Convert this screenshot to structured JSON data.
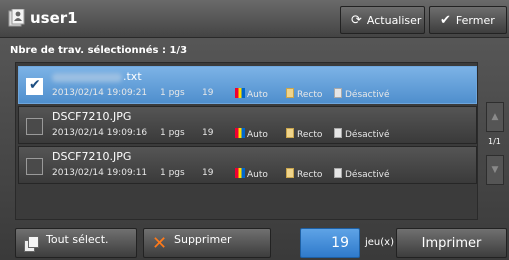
{
  "header": {
    "user": "user1",
    "refresh_label": "Actualiser",
    "close_label": "Fermer"
  },
  "selection_count": "Nbre de trav. sélectionnés : 1/3",
  "jobs": [
    {
      "name": ".txt",
      "selected": true,
      "date": "2013/02/14 19:09:21",
      "pages": "1 pgs",
      "sets": "19",
      "color": "Auto",
      "sides": "Recto",
      "staple": "Désactivé"
    },
    {
      "name": "DSCF7210.JPG",
      "selected": false,
      "date": "2013/02/14 19:09:16",
      "pages": "1 pgs",
      "sets": "19",
      "color": "Auto",
      "sides": "Recto",
      "staple": "Désactivé"
    },
    {
      "name": "DSCF7210.JPG",
      "selected": false,
      "date": "2013/02/14 19:09:11",
      "pages": "1 pgs",
      "sets": "19",
      "color": "Auto",
      "sides": "Recto",
      "staple": "Désactivé"
    }
  ],
  "page_indicator": "1/1",
  "footer": {
    "select_all_label": "Tout sélect.",
    "delete_label": "Supprimer",
    "quantity": "19",
    "quantity_unit": "jeu(x)",
    "print_label": "Imprimer"
  },
  "colors": {
    "selected_row": "#5f9fdc",
    "quantity_box": "#3f8ad6",
    "delete_icon": "#ff7a1a"
  }
}
